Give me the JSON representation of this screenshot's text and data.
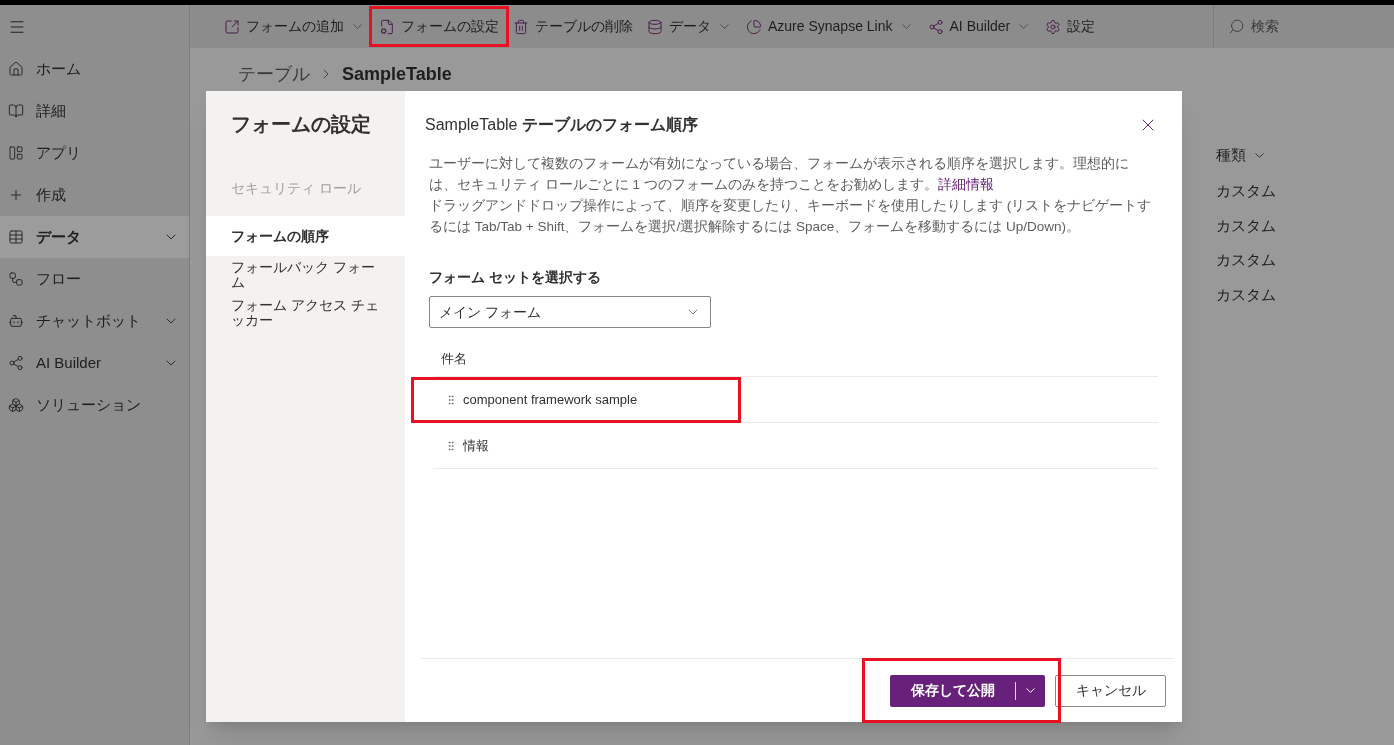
{
  "toolbar": {
    "items": [
      {
        "label": "フォームの追加",
        "dropdown": true,
        "annotated": false
      },
      {
        "label": "フォームの設定",
        "dropdown": false,
        "annotated": true
      },
      {
        "label": "テーブルの削除",
        "dropdown": false,
        "annotated": false
      },
      {
        "label": "データ",
        "dropdown": true,
        "annotated": false
      },
      {
        "label": "Azure Synapse Link",
        "dropdown": true,
        "annotated": false
      },
      {
        "label": "AI Builder",
        "dropdown": true,
        "annotated": false
      },
      {
        "label": "設定",
        "dropdown": false,
        "annotated": false
      }
    ],
    "search": {
      "placeholder": "検索"
    }
  },
  "sidebar": {
    "items": [
      {
        "label": "ホーム",
        "expandable": false,
        "selected": false
      },
      {
        "label": "詳細",
        "expandable": false,
        "selected": false
      },
      {
        "label": "アプリ",
        "expandable": false,
        "selected": false
      },
      {
        "label": "作成",
        "expandable": false,
        "selected": false
      },
      {
        "label": "データ",
        "expandable": true,
        "selected": true
      },
      {
        "label": "フロー",
        "expandable": false,
        "selected": false
      },
      {
        "label": "チャットボット",
        "expandable": true,
        "selected": false
      },
      {
        "label": "AI Builder",
        "expandable": true,
        "selected": false
      },
      {
        "label": "ソリューション",
        "expandable": false,
        "selected": false
      }
    ]
  },
  "breadcrumb": {
    "parent": "テーブル",
    "current": "SampleTable"
  },
  "background_table": {
    "column": "種類",
    "cells": [
      "カスタム",
      "カスタム",
      "カスタム",
      "カスタム"
    ]
  },
  "dialog": {
    "title": "フォームの設定",
    "nav": [
      {
        "label": "セキュリティ ロール",
        "disabled": true,
        "selected": false
      },
      {
        "label": "フォームの順序",
        "disabled": false,
        "selected": true
      },
      {
        "label": "フォールバック フォーム",
        "disabled": false,
        "selected": false
      },
      {
        "label": "フォーム アクセス チェッカー",
        "disabled": false,
        "selected": false
      }
    ],
    "heading_prefix": "SampleTable",
    "heading": "テーブルのフォーム順序",
    "description": "ユーザーに対して複数のフォームが有効になっている場合、フォームが表示される順序を選択します。理想的には、セキュリティ ロールごとに 1 つのフォームのみを持つことをお勧めします。",
    "link": "詳細情報",
    "instructions": "ドラッグアンドドロップ操作によって、順序を変更したり、キーボードを使用したりします (リストをナビゲートするには Tab/Tab + Shift、フォームを選択/選択解除するには Space、フォームを移動するには Up/Down)。",
    "form_set_label": "フォーム セットを選択する",
    "form_set_value": "メイン フォーム",
    "column": "件名",
    "rows": [
      {
        "name": "component framework sample",
        "annotated": true
      },
      {
        "name": "情報",
        "annotated": false
      }
    ],
    "primary_button": {
      "label": "保存して公開",
      "annotated": true
    },
    "secondary_button": "キャンセル"
  }
}
